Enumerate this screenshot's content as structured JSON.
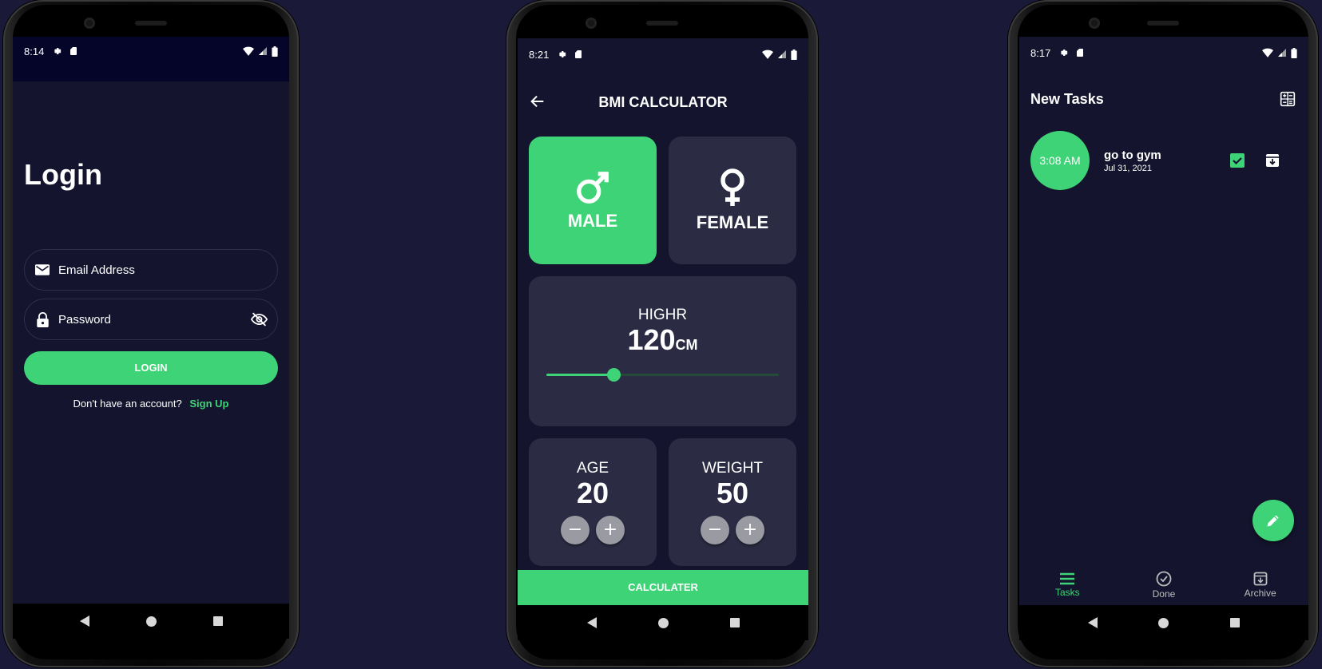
{
  "colors": {
    "background": "#1a1a38",
    "screen": "#14142e",
    "accent": "#3fd377",
    "card": "#2b2b44"
  },
  "login_app": {
    "status": {
      "time": "8:14"
    },
    "title": "Login",
    "email_placeholder": "Email Address",
    "password_placeholder": "Password",
    "login_button": "LOGIN",
    "signup_prompt": "Don't have an account?",
    "signup_link": "Sign Up",
    "icons": [
      "mail-icon",
      "lock-icon",
      "visibility-off-icon"
    ]
  },
  "bmi_app": {
    "status": {
      "time": "8:21"
    },
    "title": "BMI CALCULATOR",
    "male_label": "MALE",
    "female_label": "FEMALE",
    "selected_gender": "MALE",
    "height_label": "HIGHR",
    "height_value": "120",
    "height_unit": "CM",
    "height_slider_fraction": 0.29,
    "age_label": "AGE",
    "age_value": "20",
    "weight_label": "WEIGHT",
    "weight_value": "50",
    "minus_glyph": "−",
    "plus_glyph": "+",
    "calculate_button": "CALCULATER"
  },
  "tasks_app": {
    "status": {
      "time": "8:17"
    },
    "title": "New Tasks",
    "tasks": [
      {
        "time": "3:08 AM",
        "name": "go to gym",
        "date": "Jul 31, 2021"
      }
    ],
    "bottom_nav": [
      {
        "label": "Tasks",
        "icon": "menu-icon",
        "active": true
      },
      {
        "label": "Done",
        "icon": "check-circle-icon",
        "active": false
      },
      {
        "label": "Archive",
        "icon": "archive-icon",
        "active": false
      }
    ]
  }
}
